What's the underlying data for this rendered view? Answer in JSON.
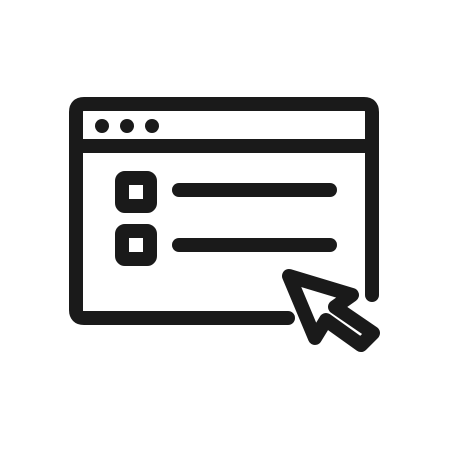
{
  "icon": {
    "name": "browser-window-checklist-cursor-icon",
    "parts": {
      "window": "browser-window-icon",
      "title_dots": "window-controls-icon",
      "checkbox_1": "checkbox-icon",
      "checkbox_2": "checkbox-icon",
      "line_1": "text-line-icon",
      "line_2": "text-line-icon",
      "cursor": "mouse-pointer-arrow-icon"
    }
  },
  "colors": {
    "stroke": "#1a1a1a",
    "background": "#ffffff"
  }
}
